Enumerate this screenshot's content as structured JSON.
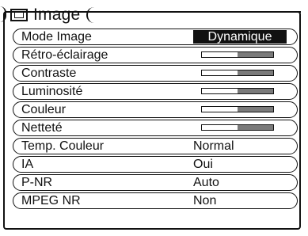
{
  "header": {
    "title": "Image",
    "icon": "picture-frame-icon"
  },
  "menu": {
    "rows": [
      {
        "label": "Mode  Image",
        "type": "select",
        "value": "Dynamique",
        "selected": true
      },
      {
        "label": "Rétro-éclairage",
        "type": "slider",
        "level": 0.5
      },
      {
        "label": "Contraste",
        "type": "slider",
        "level": 0.5
      },
      {
        "label": "Luminosité",
        "type": "slider",
        "level": 0.5
      },
      {
        "label": "Couleur",
        "type": "slider",
        "level": 0.5
      },
      {
        "label": "Netteté",
        "type": "slider",
        "level": 0.5
      },
      {
        "label": "Temp. Couleur",
        "type": "select",
        "value": "Normal"
      },
      {
        "label": "IA",
        "type": "select",
        "value": "Oui"
      },
      {
        "label": "P-NR",
        "type": "select",
        "value": "Auto"
      },
      {
        "label": "MPEG NR",
        "type": "select",
        "value": "Non"
      }
    ]
  },
  "colors": {
    "foreground": "#111111",
    "background": "#ffffff",
    "slider_fill": "#7a7a7a"
  }
}
